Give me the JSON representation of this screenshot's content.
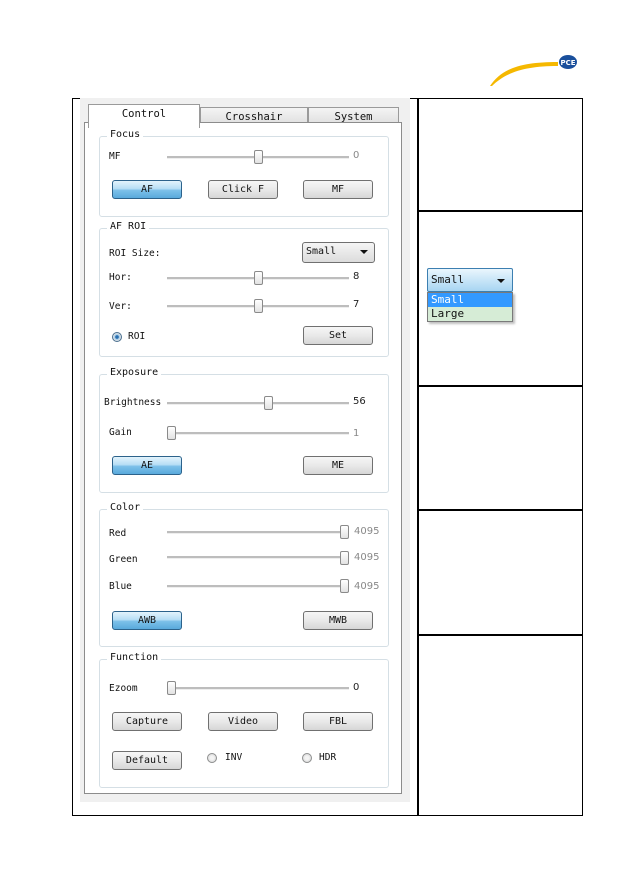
{
  "logo": {
    "text": "PCE",
    "swoosh_color": "#f5b800",
    "badge_color": "#1a4f9c"
  },
  "tabs": [
    {
      "label": "Control",
      "active": true
    },
    {
      "label": "Crosshair",
      "active": false
    },
    {
      "label": "System",
      "active": false
    }
  ],
  "focus": {
    "title": "Focus",
    "slider": {
      "label": "MF",
      "value": "0",
      "position_fraction": 0.5
    },
    "buttons": [
      {
        "label": "AF",
        "active": true
      },
      {
        "label": "Click F",
        "active": false
      },
      {
        "label": "MF",
        "active": false
      }
    ]
  },
  "af_roi": {
    "title": "AF ROI",
    "roi_size_label": "ROI Size:",
    "roi_size_value": "Small",
    "sliders": [
      {
        "label": "Hor:",
        "value": "8",
        "position_fraction": 0.5
      },
      {
        "label": "Ver:",
        "value": "7",
        "position_fraction": 0.5
      }
    ],
    "roi_radio": {
      "label": "ROI",
      "checked": true
    },
    "set_button": "Set"
  },
  "exposure": {
    "title": "Exposure",
    "sliders": [
      {
        "label": "Brightness",
        "value": "56",
        "position_fraction": 0.56
      },
      {
        "label": "Gain",
        "value": "1",
        "position_fraction": 0.0
      }
    ],
    "buttons": [
      {
        "label": "AE",
        "active": true
      },
      {
        "label": "ME",
        "active": false
      }
    ]
  },
  "color": {
    "title": "Color",
    "sliders": [
      {
        "label": "Red",
        "value": "4095",
        "position_fraction": 1.0
      },
      {
        "label": "Green",
        "value": "4095",
        "position_fraction": 1.0
      },
      {
        "label": "Blue",
        "value": "4095",
        "position_fraction": 1.0
      }
    ],
    "buttons": [
      {
        "label": "AWB",
        "active": true
      },
      {
        "label": "MWB",
        "active": false
      }
    ]
  },
  "function": {
    "title": "Function",
    "slider": {
      "label": "Ezoom",
      "value": "0",
      "position_fraction": 0.0
    },
    "buttons": [
      {
        "label": "Capture"
      },
      {
        "label": "Video"
      },
      {
        "label": "FBL"
      },
      {
        "label": "Default"
      }
    ],
    "radios": [
      {
        "label": "INV",
        "checked": false
      },
      {
        "label": "HDR",
        "checked": false
      }
    ]
  },
  "dropdown_illustration": {
    "selected": "Small",
    "options": [
      {
        "label": "Small",
        "highlighted": true
      },
      {
        "label": "Large",
        "highlighted": false
      }
    ]
  }
}
